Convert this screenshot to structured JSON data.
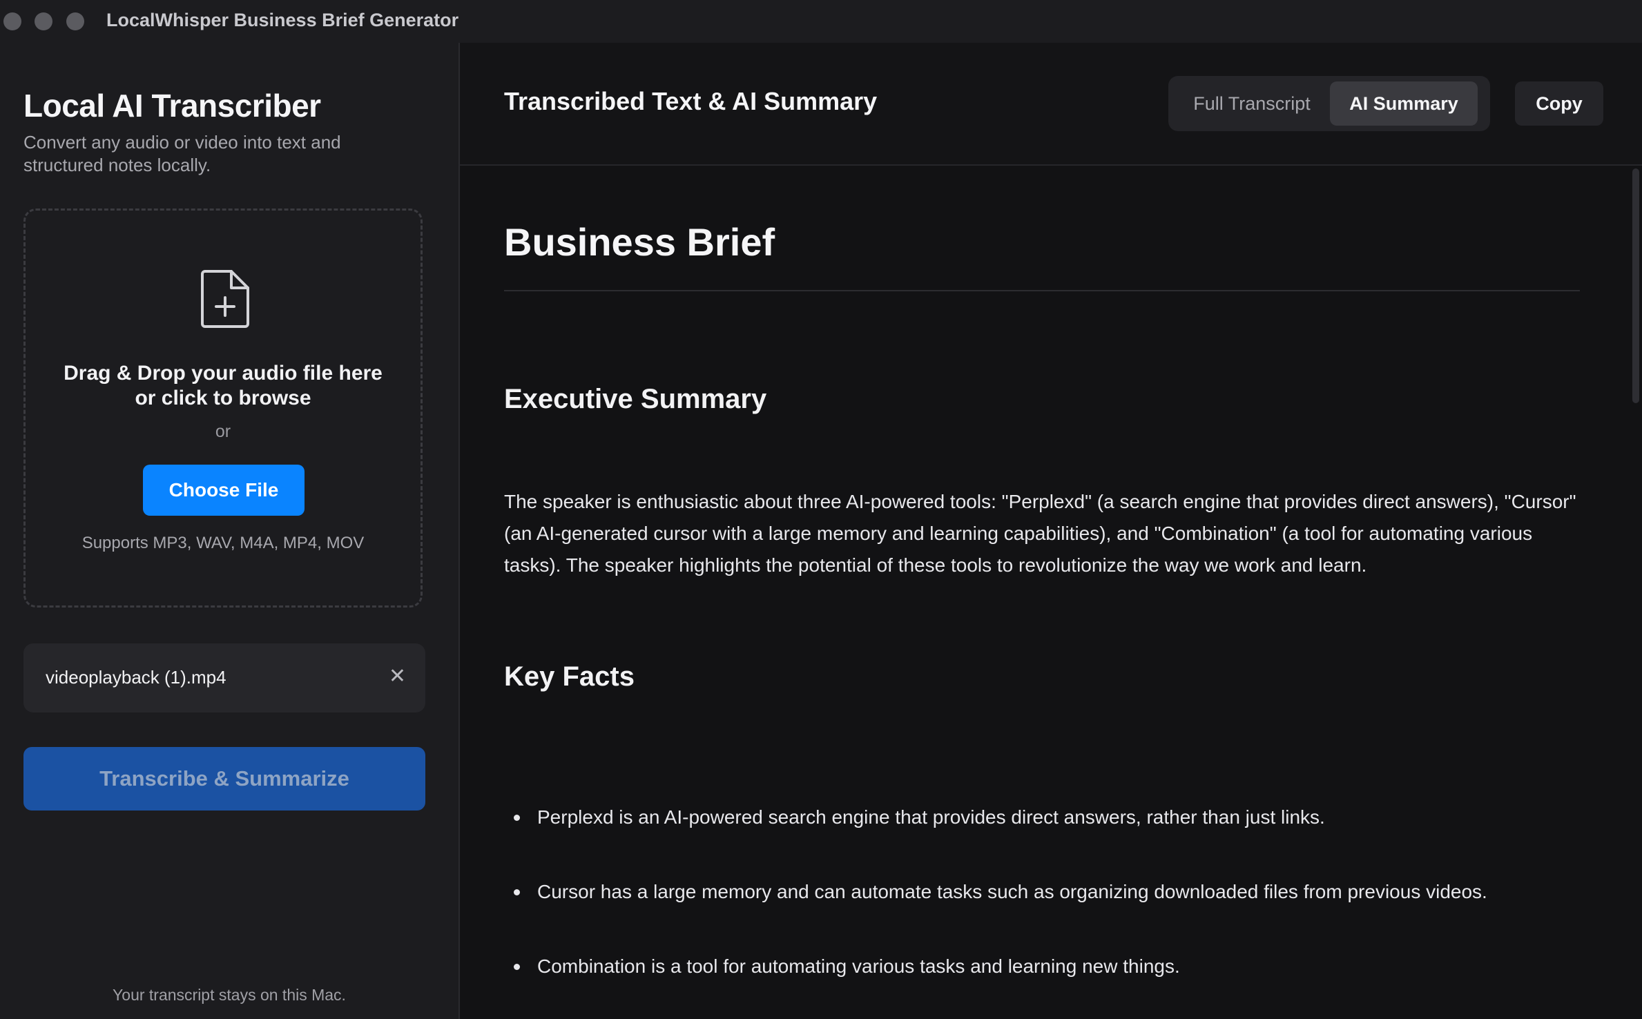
{
  "window": {
    "title": "LocalWhisper Business Brief Generator"
  },
  "sidebar": {
    "title": "Local AI Transcriber",
    "subtitle": "Convert any audio or video into text and structured notes locally.",
    "dropzone": {
      "icon": "file-plus-icon",
      "line1": "Drag & Drop your audio file here",
      "line2": "or click to browse",
      "or_text": "or",
      "choose_label": "Choose File",
      "supports_text": "Supports MP3, WAV, M4A, MP4, MOV"
    },
    "selected_file": {
      "name": "videoplayback (1).mp4",
      "remove_glyph": "✕"
    },
    "transcribe_label": "Transcribe & Summarize",
    "privacy_note": "Your transcript stays on this Mac."
  },
  "main": {
    "header_title": "Transcribed Text & AI Summary",
    "tabs": [
      {
        "label": "Full Transcript",
        "selected": false
      },
      {
        "label": "AI Summary",
        "selected": true
      }
    ],
    "copy_label": "Copy",
    "brief": {
      "title": "Business Brief",
      "executive_summary_heading": "Executive Summary",
      "executive_summary": "The speaker is enthusiastic about three AI-powered tools: \"Perplexd\" (a search engine that provides direct answers), \"Cursor\" (an AI-generated cursor with a large memory and learning capabilities), and \"Combination\" (a tool for automating various tasks). The speaker highlights the potential of these tools to revolutionize the way we work and learn.",
      "key_facts_heading": "Key Facts",
      "key_facts": [
        "Perplexd is an AI-powered search engine that provides direct answers, rather than just links.",
        "Cursor has a large memory and can automate tasks such as organizing downloaded files from previous videos.",
        "Combination is a tool for automating various tasks and learning new things."
      ]
    }
  },
  "colors": {
    "accent": "#0a84ff",
    "primary_button": "#1b52a3",
    "background": "#121214",
    "sidebar": "#1c1c1f"
  }
}
